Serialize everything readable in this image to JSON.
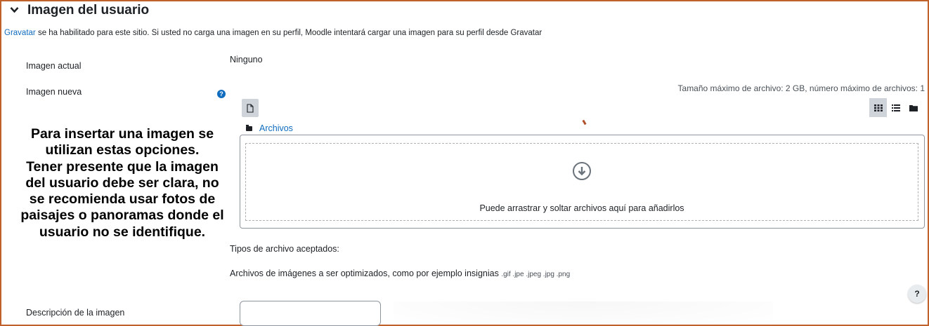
{
  "section": {
    "title": "Imagen del usuario",
    "chevron_icon": "chevron-down-icon"
  },
  "gravatar": {
    "link_text": "Gravatar",
    "rest_text": " se ha habilitado para este sitio. Si usted no carga una imagen en su perfil, Moodle intentará cargar una imagen para su perfil desde Gravatar"
  },
  "fields": {
    "current_image_label": "Imagen actual",
    "current_image_value": "Ninguno",
    "new_image_label": "Imagen nueva",
    "description_label": "Descripción de la imagen"
  },
  "filepicker": {
    "limits": "Tamaño máximo de archivo: 2 GB, número máximo de archivos: 1",
    "folder_label": "Archivos",
    "drop_text": "Puede arrastrar y soltar archivos aquí para añadirlos",
    "accepted_title": "Tipos de archivo aceptados:",
    "accepted_desc": "Archivos de imágenes a ser optimizados, como por ejemplo insignias",
    "accepted_ext": ".gif .jpe .jpeg .jpg .png",
    "icons": [
      "add-file-icon",
      "icon-view-grid-icon",
      "list-view-icon",
      "folder-view-icon",
      "download-arrow-icon"
    ]
  },
  "callout": {
    "line1": "Para insertar una imagen se utilizan estas opciones.",
    "line2": "Tener presente que la imagen del usuario debe ser clara, no se recomienda usar fotos de paisajes o panoramas donde el usuario no se identifique."
  },
  "help": {
    "small_icon": "?",
    "floating_button": "?"
  },
  "colors": {
    "link": "#0f6cbf",
    "border_frame": "#c0602a",
    "text": "#1d2125"
  }
}
